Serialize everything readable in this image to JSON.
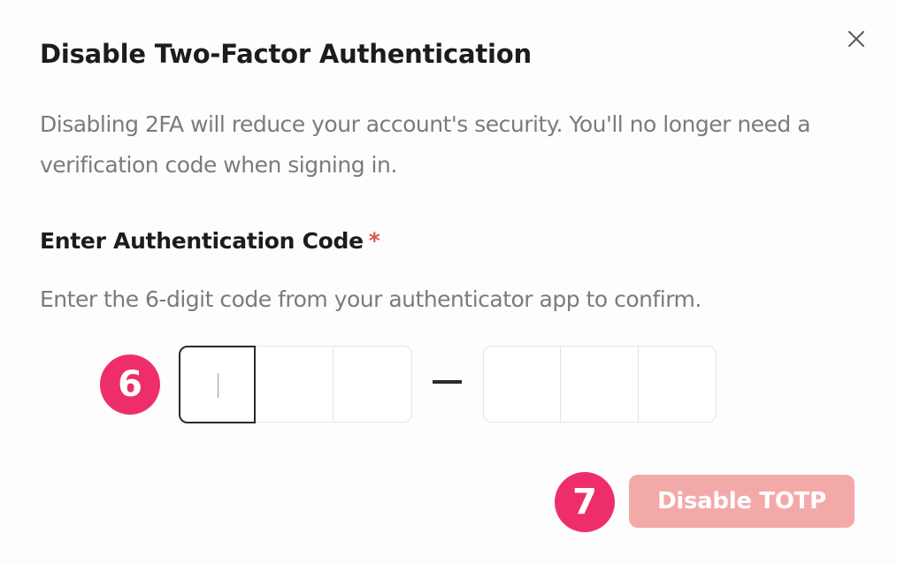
{
  "dialog": {
    "title": "Disable Two-Factor Authentication",
    "description": "Disabling 2FA will reduce your account's security. You'll no longer need a verification code when signing in.",
    "close_icon": "close-icon"
  },
  "code_field": {
    "label": "Enter Authentication Code",
    "required_mark": "*",
    "hint": "Enter the 6-digit code from your authenticator app to confirm.",
    "digits": [
      "",
      "",
      "",
      "",
      "",
      ""
    ],
    "active_index": 0
  },
  "annotations": {
    "step_6": "6",
    "step_7": "7"
  },
  "actions": {
    "disable_label": "Disable TOTP",
    "disable_enabled": false
  },
  "colors": {
    "badge": "#ee2e6b",
    "button_disabled": "#f4a9a9",
    "required": "#d9534f"
  }
}
